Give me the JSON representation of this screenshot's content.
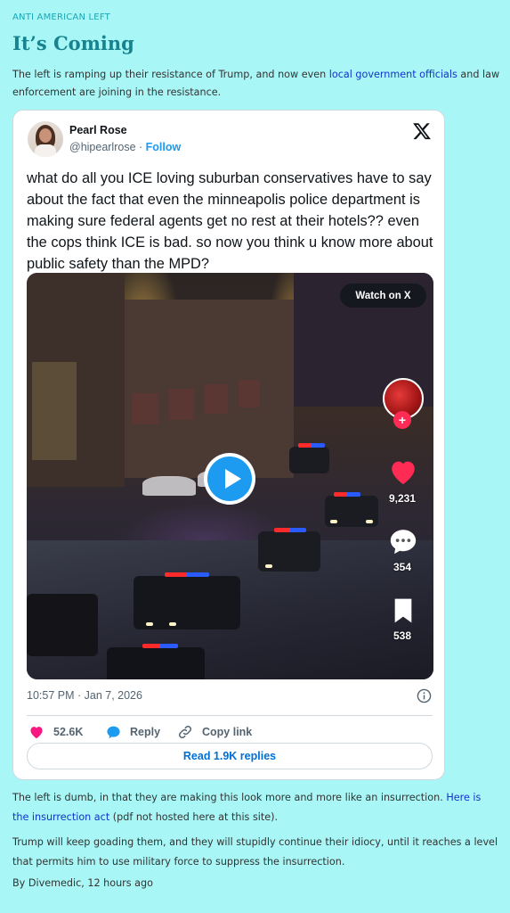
{
  "post": {
    "category": "ANTI AMERICAN LEFT",
    "title": "It’s Coming",
    "intro_pre": "The left is ramping up their resistance of Trump, and now even ",
    "intro_link": "local government officials",
    "intro_post": " and law enforcement are joining in the resistance.",
    "para2_pre": "The left is dumb, in that they are making this look more and more like an insurrection. ",
    "para2_link": "Here is the insurrection act",
    "para2_post": " (pdf not hosted here at this site).",
    "para3": "Trump will keep goading them, and they will stupidly continue their idiocy, until it reaches a level that permits him to use military force to suppress the insurrection.",
    "byline_prefix": "By ",
    "author": "Divemedic",
    "byline_time": ", 12 hours ago"
  },
  "tweet": {
    "display_name": "Pearl Rose",
    "handle": "@hipearlrose",
    "separator": " · ",
    "follow_label": "Follow",
    "text": "what do all you ICE loving suburban conservatives have to say about the fact that even the minneapolis police department is making sure federal agents get no rest at their hotels?? even the cops think ICE is bad. so now you think u know more about public safety than the MPD?",
    "watch_label": "Watch on X",
    "video_overlay": {
      "likes": "9,231",
      "comments": "354",
      "saves": "538",
      "follow_plus": "+"
    },
    "timestamp": "10:57 PM · Jan 7, 2026",
    "like_count": "52.6K",
    "reply_label": "Reply",
    "copy_label": "Copy link",
    "read_replies_label": "Read 1.9K replies"
  },
  "icons": {
    "x_logo": "x-logo-icon",
    "like": "heart-icon",
    "reply": "speech-bubble-icon",
    "copy": "link-icon",
    "info": "info-icon",
    "play": "play-icon"
  },
  "colors": {
    "page_background": "#a8f6f6",
    "title": "#17838f",
    "category": "#1aa7b5",
    "link": "#1133cc",
    "x_blue": "#1d9bf0",
    "like_pink": "#f91880"
  }
}
